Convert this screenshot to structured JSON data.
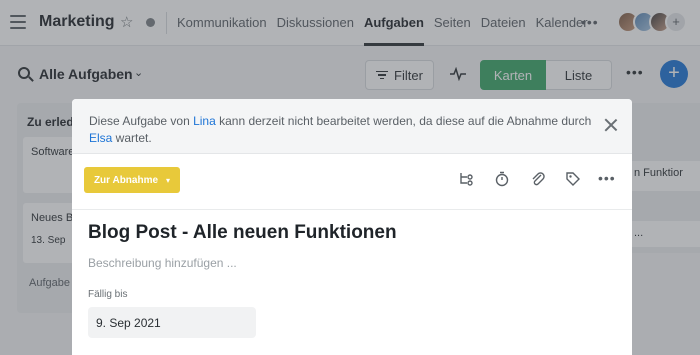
{
  "workspace": {
    "title": "Marketing"
  },
  "nav": {
    "tabs": [
      {
        "label": "Kommunikation"
      },
      {
        "label": "Diskussionen"
      },
      {
        "label": "Aufgaben",
        "active": true
      },
      {
        "label": "Seiten"
      },
      {
        "label": "Dateien"
      },
      {
        "label": "Kalender"
      }
    ],
    "more_label": "•••",
    "add_member_label": "+"
  },
  "toolbar": {
    "view_title": "Alle Aufgaben",
    "filter_label": "Filter",
    "cards_label": "Karten",
    "list_label": "Liste",
    "more_label": "•••",
    "add_label": "+"
  },
  "board": {
    "column_title": "Zu erled",
    "card1_text": "Software Materia",
    "card2_text": "Neues B",
    "card2_date": "13. Sep",
    "add_label": "Aufgabe",
    "right_card1": "n Funktior",
    "right_card2": "..."
  },
  "modal": {
    "notice_pre": "Diese Aufgabe von ",
    "notice_user1": "Lina",
    "notice_mid": " kann derzeit nicht bearbeitet werden, da diese auf die Abnahme durch ",
    "notice_user2": "Elsa",
    "notice_post": " wartet.",
    "status_label": "Zur Abnahme",
    "more_label": "•••",
    "task_title": "Blog Post - Alle neuen Funktionen",
    "description_placeholder": "Beschreibung hinzufügen ...",
    "due_label": "Fällig bis",
    "due_value": "9. Sep 2021"
  },
  "colors": {
    "accent_green": "#3aa567",
    "accent_blue": "#1d74d6",
    "status_yellow": "#e8c93a"
  }
}
